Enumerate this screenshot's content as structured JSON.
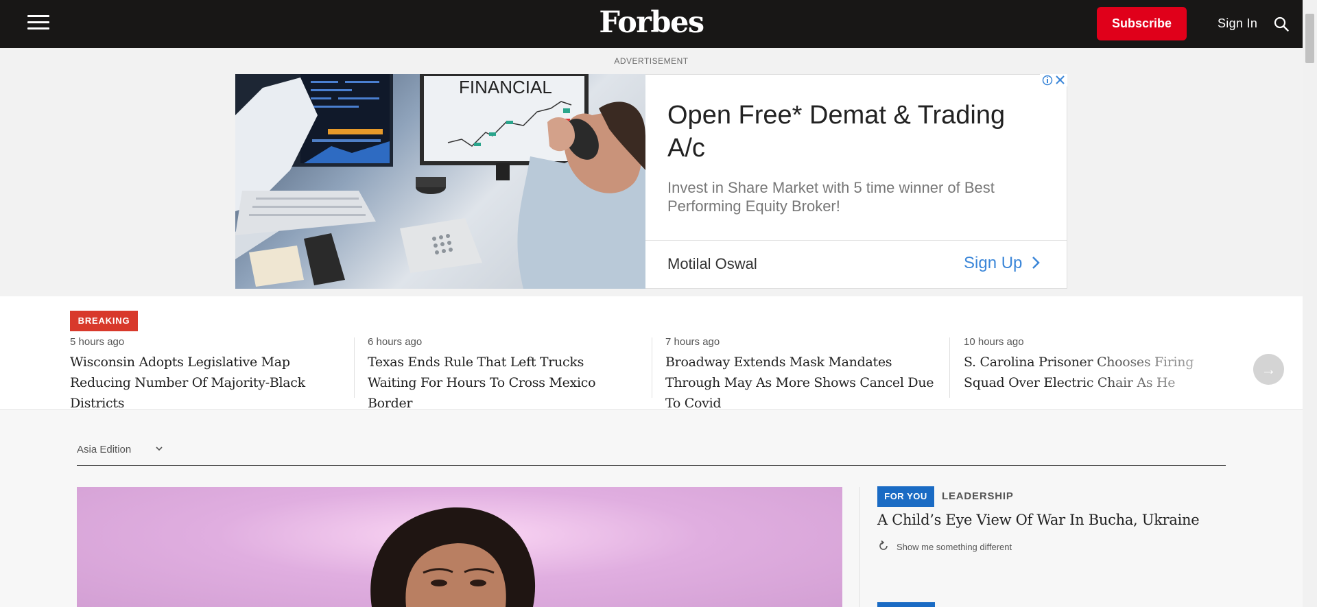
{
  "header": {
    "logo": "Forbes",
    "subscribe_label": "Subscribe",
    "signin_label": "Sign In"
  },
  "ad": {
    "label": "ADVERTISEMENT",
    "image_caption": "FINANCIAL",
    "title": "Open Free* Demat & Trading A/c",
    "description": "Invest in Share Market with 5 time winner of Best Performing Equity Broker!",
    "brand": "Motilal Oswal",
    "cta": "Sign Up"
  },
  "breaking": {
    "badge": "BREAKING",
    "items": [
      {
        "time": "5 hours ago",
        "headline": "Wisconsin Adopts Legislative Map Reducing Number Of Majority-Black Districts"
      },
      {
        "time": "6 hours ago",
        "headline": "Texas Ends Rule That Left Trucks Waiting For Hours To Cross Mexico Border"
      },
      {
        "time": "7 hours ago",
        "headline": "Broadway Extends Mask Mandates Through May As More Shows Cancel Due To Covid"
      },
      {
        "time": "10 hours ago",
        "headline": "S. Carolina Prisoner Chooses Firing Squad Over Electric Chair As He Challenges Law…"
      }
    ],
    "next_arrow": "→"
  },
  "edition": {
    "label": "Asia Edition"
  },
  "sidebar": {
    "badge": "FOR YOU",
    "category": "LEADERSHIP",
    "headline": "A Child’s Eye View Of War In Bucha, Ukraine",
    "show_different": "Show me something different"
  },
  "colors": {
    "header_bg": "#181716",
    "subscribe": "#e0001a",
    "breaking": "#d8392b",
    "for_you": "#1a6bc4",
    "ad_cta": "#3b86d8"
  }
}
